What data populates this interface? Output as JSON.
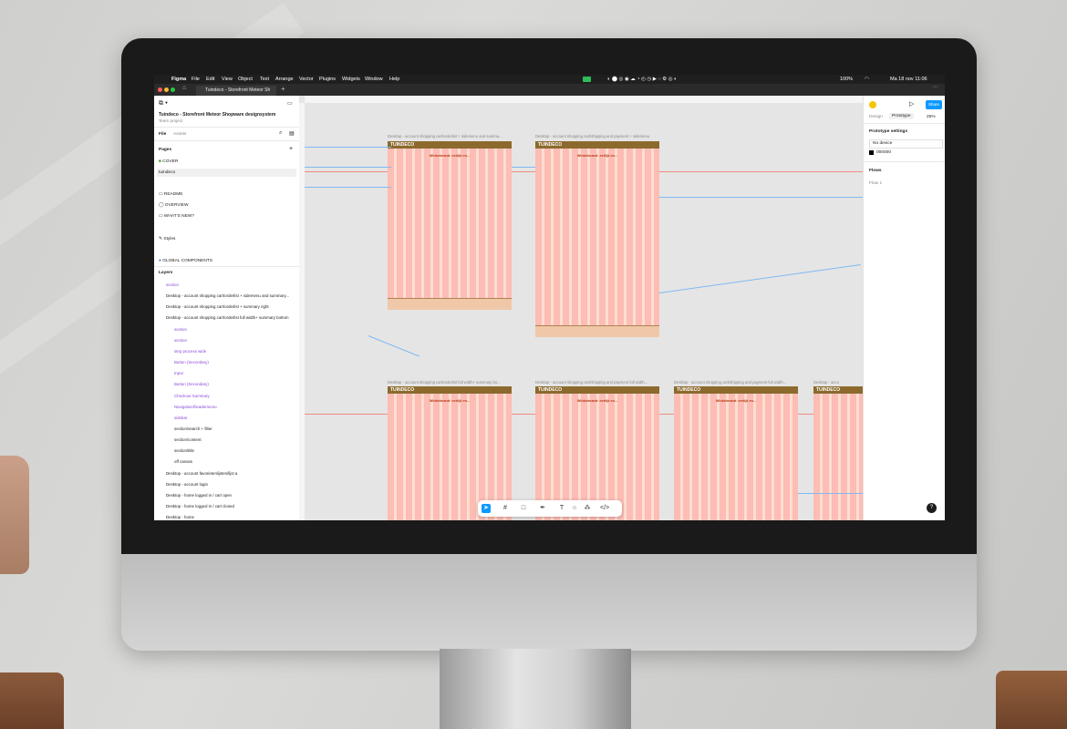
{
  "menubar": {
    "app": "Figma",
    "items": [
      "File",
      "Edit",
      "View",
      "Object",
      "Text",
      "Arrange",
      "Vector",
      "Plugins",
      "Widgets",
      "Window",
      "Help"
    ],
    "battery": "100%",
    "clock": "Ma 18 nov 11:06"
  },
  "tab": {
    "title": "Tuindeco - Storefront Meteor Sh"
  },
  "file": {
    "name": "Tuindeco - Storefront Meteor Shopware designsystem",
    "team": "Team project",
    "tabs": [
      "File",
      "Assets"
    ]
  },
  "pages": {
    "header": "Pages",
    "items": [
      "COVER",
      "tuindeco",
      "README",
      "OVERVIEW",
      "WHAT'S NEW?",
      "Styles",
      "GLOBAL COMPONENTS"
    ]
  },
  "layers": {
    "header": "Layers",
    "items": [
      {
        "label": "section",
        "purple": true,
        "indent": 0
      },
      {
        "label": "Desktop - account shopping cart/orderlist + sidemenu and summary...",
        "purple": false,
        "indent": 0
      },
      {
        "label": "Desktop - account shopping cart/orderlist + summary right",
        "purple": false,
        "indent": 0
      },
      {
        "label": "Desktop - account shopping cart/orderlist full width+ summary bottom",
        "purple": false,
        "indent": 0
      },
      {
        "label": "section",
        "purple": true,
        "indent": 1
      },
      {
        "label": "section",
        "purple": true,
        "indent": 1
      },
      {
        "label": "step process wide",
        "purple": true,
        "indent": 1
      },
      {
        "label": "Button (Secondary)",
        "purple": true,
        "indent": 1
      },
      {
        "label": "Input",
        "purple": true,
        "indent": 1
      },
      {
        "label": "Button (Secondary)",
        "purple": true,
        "indent": 1
      },
      {
        "label": "Checkout Summary",
        "purple": true,
        "indent": 1
      },
      {
        "label": "Navigation/headermenu",
        "purple": true,
        "indent": 1
      },
      {
        "label": "sidebar",
        "purple": true,
        "indent": 1
      },
      {
        "label": "section/search + filter",
        "purple": false,
        "indent": 1
      },
      {
        "label": "section/content",
        "purple": false,
        "indent": 1
      },
      {
        "label": "section/title",
        "purple": false,
        "indent": 1
      },
      {
        "label": "off canvas",
        "purple": false,
        "indent": 1
      },
      {
        "label": "Desktop - account favorietenlijsten/lijst a",
        "purple": false,
        "indent": 0
      },
      {
        "label": "Desktop - account login",
        "purple": false,
        "indent": 0
      },
      {
        "label": "Desktop - home logged in / cart open",
        "purple": false,
        "indent": 0
      },
      {
        "label": "Desktop - home logged in / cart closed",
        "purple": false,
        "indent": 0
      },
      {
        "label": "Desktop - home",
        "purple": false,
        "indent": 0
      }
    ]
  },
  "right_panel": {
    "share": "Share",
    "tabs": [
      "Design",
      "Prototype"
    ],
    "zoom": "25%",
    "prototype_settings": "Prototype settings",
    "device": "No device",
    "bg_color": "000000",
    "flows": "Flows",
    "flow_item": "Flow 1"
  },
  "canvas": {
    "logo": "TUINDECO",
    "heading": "Winkelmand: eerlijk en..."
  },
  "frames": [
    {
      "title": "Desktop - account shopping cart/orderlist + sidemenu and summa..."
    },
    {
      "title": "Desktop - account shopping cart/shipping and payment + sidemenu"
    },
    {
      "title": "Desktop - account shopping cart/orderlist full width+ summary bo..."
    },
    {
      "title": "Desktop - account shopping cart/shipping and payment full width..."
    },
    {
      "title": "Desktop - account shopping cart/shipping and payment full width..."
    },
    {
      "title": "Desktop - acco"
    }
  ],
  "colors": {
    "accent": "#0d99ff",
    "brand": "#8c6a2d",
    "layer_purple": "#8a4bd6"
  }
}
